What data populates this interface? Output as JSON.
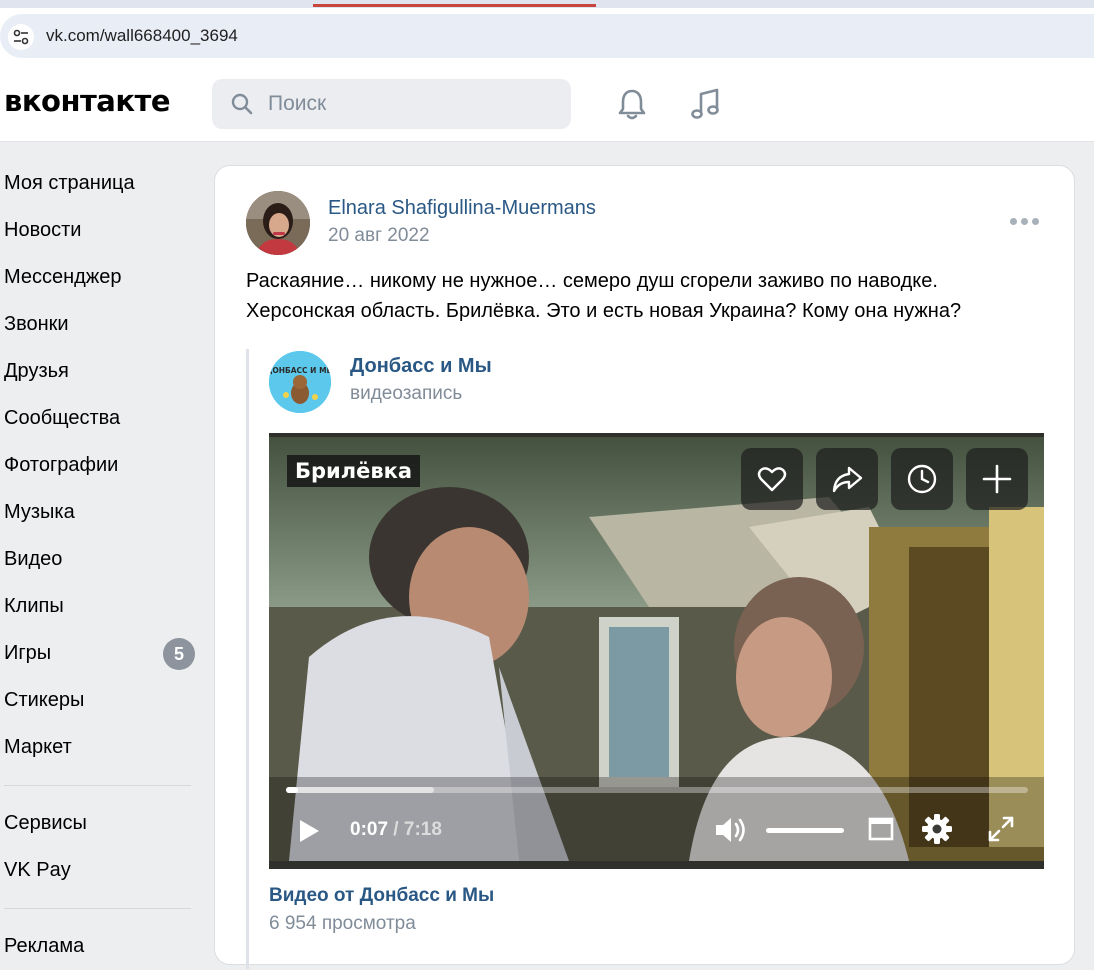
{
  "browser": {
    "url": "vk.com/wall668400_3694"
  },
  "header": {
    "logo": "вконтакте",
    "search_placeholder": "Поиск"
  },
  "sidebar": {
    "items": [
      {
        "label": "Моя страница"
      },
      {
        "label": "Новости"
      },
      {
        "label": "Мессенджер"
      },
      {
        "label": "Звонки"
      },
      {
        "label": "Друзья"
      },
      {
        "label": "Сообщества"
      },
      {
        "label": "Фотографии"
      },
      {
        "label": "Музыка"
      },
      {
        "label": "Видео"
      },
      {
        "label": "Клипы"
      },
      {
        "label": "Игры",
        "badge": "5"
      },
      {
        "label": "Стикеры"
      },
      {
        "label": "Маркет"
      }
    ],
    "secondary": [
      {
        "label": "Сервисы"
      },
      {
        "label": "VK Pay"
      }
    ],
    "tertiary": [
      {
        "label": "Реклама"
      }
    ]
  },
  "post": {
    "author": "Elnara Shafigullina-Muermans",
    "date": "20 авг 2022",
    "text": "Раскаяние… никому не нужное… семеро душ сгорели заживо по наводке. Херсонская область. Брилёвка. Это и есть новая Украина? Кому она нужна?",
    "repost": {
      "group_name": "Донбасс и Мы",
      "group_avatar_text": "ДОНБАСС И МЫ",
      "subtitle": "видеозапись",
      "video": {
        "overlay_label": "Брилёвка",
        "current_time": "0:07",
        "duration": "7:18",
        "progress_fraction": 0.016,
        "buffered_fraction": 0.2,
        "volume_fraction": 1.0
      },
      "caption": "Видео от Донбасс и Мы",
      "views": "6 954 просмотра"
    }
  },
  "colors": {
    "link": "#2a5885",
    "muted": "#818c99",
    "page_bg": "#edeef0"
  }
}
